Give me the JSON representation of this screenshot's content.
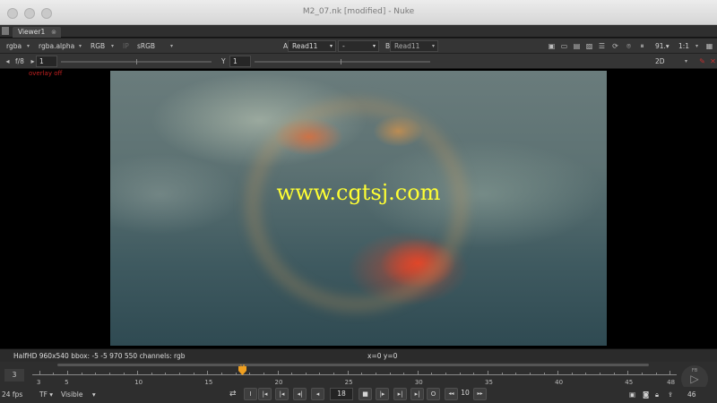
{
  "window": {
    "title": "M2_07.nk [modified] - Nuke"
  },
  "tabs": [
    {
      "label": "Viewer1",
      "close_icon": "close-icon"
    }
  ],
  "toolbar1": {
    "channels": "rgba",
    "alpha_channel": "rgba.alpha",
    "display": "RGB",
    "ip_label": "IP",
    "lut": "sRGB",
    "input_a_label": "A",
    "input_a_value": "Read11",
    "compare_value": "-",
    "input_b_label": "B",
    "input_b_value": "Read11",
    "zoom": "91.▾",
    "proxy": "1:1"
  },
  "toolbar2": {
    "fstop": "f/8",
    "gain_value": "1",
    "gamma_label": "Y",
    "gamma_value": "1",
    "view_mode": "2D"
  },
  "viewer": {
    "overlay_label": "overlay off",
    "watermark": "www.cgtsj.com"
  },
  "info": {
    "left": "HalfHD 960x540  bbox: -5 -5 970 550 channels: rgb",
    "right": "x=0 y=0"
  },
  "timeline": {
    "in_frame": "3",
    "playhead_frame": "18",
    "ticks": [
      "3",
      "5",
      "10",
      "15",
      "20",
      "25",
      "30",
      "35",
      "40",
      "45",
      "48"
    ],
    "out_frame": "46",
    "out_label": "FB"
  },
  "controls": {
    "fps": "24 fps",
    "tf": "TF",
    "visible": "Visible",
    "current_frame": "18",
    "increment": "10",
    "o_label": "O",
    "i_label": "I"
  },
  "colors": {
    "watermark": "#ffff33",
    "playhead": "#f0a020",
    "overlay": "#c02020"
  }
}
